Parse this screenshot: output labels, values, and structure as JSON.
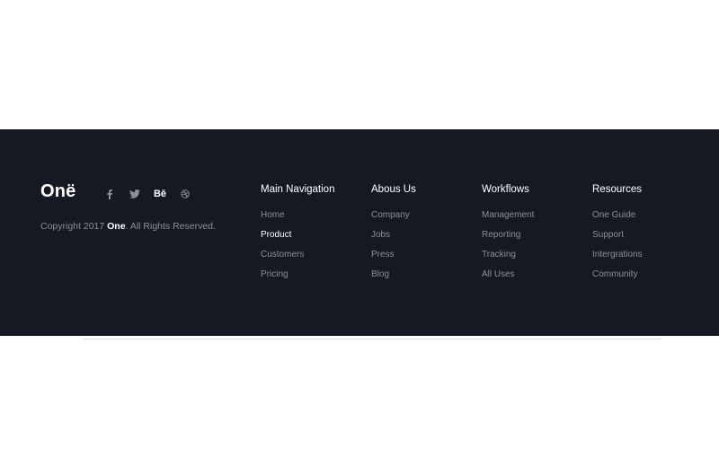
{
  "brand": {
    "logo": "Onë",
    "copyright_prefix": "Copyright 2017",
    "copyright_brand": "One",
    "copyright_suffix": ". All Rights Reserved."
  },
  "social": [
    {
      "name": "facebook-icon",
      "glyph": "f"
    },
    {
      "name": "twitter-icon",
      "glyph": "twitter"
    },
    {
      "name": "behance-icon",
      "glyph": "Bē"
    },
    {
      "name": "dribbble-icon",
      "glyph": "dribbble"
    }
  ],
  "columns": [
    {
      "title": "Main Navigation",
      "links": [
        "Home",
        "Product",
        "Customers",
        "Pricing"
      ],
      "active": "Product"
    },
    {
      "title": "Abous Us",
      "links": [
        "Company",
        "Jobs",
        "Press",
        "Blog"
      ]
    },
    {
      "title": "Workflows",
      "links": [
        "Management",
        "Reporting",
        "Tracking",
        "All Uses"
      ]
    },
    {
      "title": "Resources",
      "links": [
        "One Guide",
        "Support",
        "Intergrations",
        "Community"
      ]
    }
  ],
  "colors": {
    "footer_bg": "#161824",
    "muted_text": "#8c8f9a",
    "heading_text": "#ffffff"
  }
}
